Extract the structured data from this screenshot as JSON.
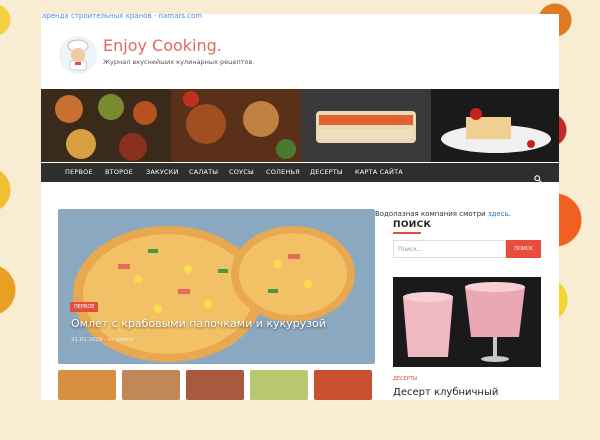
{
  "top_ad": {
    "text": "аренда строительных кранов - namars.com"
  },
  "header": {
    "site_title": "Enjoy Cooking.",
    "site_description": "Журнал вкуснейших кулинарных рецептов."
  },
  "nav": {
    "items": [
      "ПЕРВОЕ",
      "ВТОРОЕ",
      "ЗАКУСКИ",
      "САЛАТЫ",
      "СОУСЫ",
      "СОЛЕНЬЯ",
      "ДЕСЕРТЫ",
      "КАРТА САЙТА"
    ],
    "search_icon": "search-icon"
  },
  "hero": {
    "category": "ПЕРВОЕ",
    "title": "Омлет с крабовыми палочками и кукурузой",
    "meta": "21.01.2023 - от admin"
  },
  "sidebar": {
    "note_prefix": "Водолазная компания смотри ",
    "note_link": "здесь",
    "note_suffix": ".",
    "search_heading": "ПОИСК",
    "search_placeholder": "Поиск...",
    "search_button": "ПОИСК",
    "featured_category": "ДЕСЕРТЫ",
    "featured_title": "Десерт клубничный"
  },
  "colors": {
    "accent": "#e74c3c",
    "title": "#e06a5f",
    "nav_bg": "#2e2e2e"
  }
}
